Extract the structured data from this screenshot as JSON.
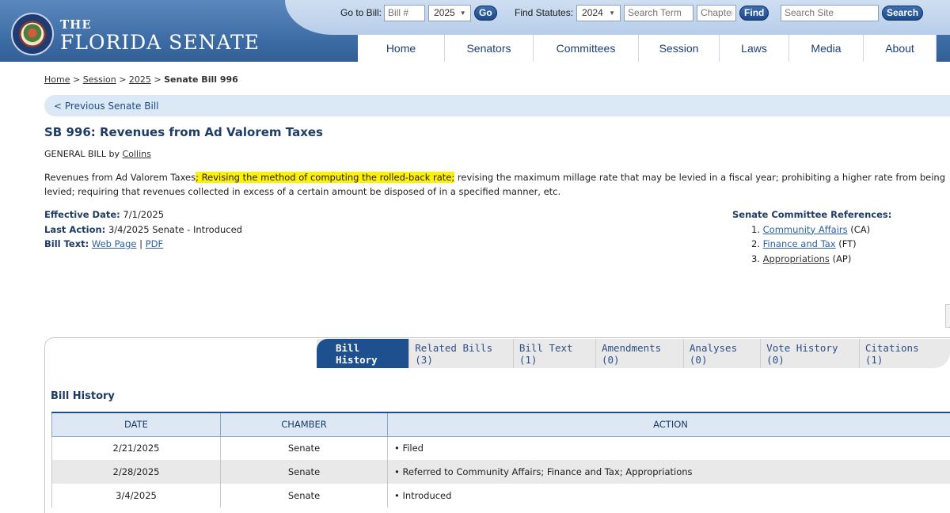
{
  "site": {
    "brand_the": "THE",
    "brand_name": "FLORIDA SENATE"
  },
  "topbar": {
    "goto_label": "Go to Bill:",
    "bill_placeholder": "Bill #",
    "year_value": "2025",
    "go_label": "Go",
    "statutes_label": "Find Statutes:",
    "statutes_year": "2024",
    "search_term_placeholder": "Search Term",
    "chapter_placeholder": "Chapter",
    "find_label": "Find",
    "site_search_placeholder": "Search Site",
    "search_label": "Search"
  },
  "nav": {
    "items": [
      "Home",
      "Senators",
      "Committees",
      "Session",
      "Laws",
      "Media",
      "About"
    ]
  },
  "breadcrumb": {
    "home": "Home",
    "session": "Session",
    "year": "2025",
    "sep": ">",
    "current": "Senate Bill 996"
  },
  "prev_bill": "< Previous Senate Bill",
  "bill": {
    "title": "SB 996: Revenues from Ad Valorem Taxes",
    "type_text": "GENERAL BILL by",
    "sponsor": "Collins",
    "desc_start": "Revenues from Ad Valorem Taxes",
    "desc_highlight": "; Revising the method of computing the rolled-back rate;",
    "desc_rest": " revising the maximum millage rate that may be levied in a fiscal year; prohibiting a higher rate from being levied; requiring that revenues collected in excess of a certain amount be disposed of in a specified manner, etc.",
    "effective_label": "Effective Date:",
    "effective_value": "7/1/2025",
    "last_action_label": "Last Action:",
    "last_action_value": "3/4/2025 Senate - Introduced",
    "bill_text_label": "Bill Text:",
    "web_page": "Web Page",
    "pdf": "PDF",
    "text_sep": "|"
  },
  "committee_refs": {
    "title": "Senate Committee References:",
    "items": [
      {
        "num": "1.",
        "name": "Community Affairs",
        "code": "(CA)"
      },
      {
        "num": "2.",
        "name": "Finance and Tax",
        "code": "(FT)"
      },
      {
        "num": "3.",
        "name": "Appropriations",
        "code": "(AP)"
      }
    ]
  },
  "tabs": [
    "Bill History",
    "Related Bills (3)",
    "Bill Text (1)",
    "Amendments (0)",
    "Analyses (0)",
    "Vote History (0)",
    "Citations (1)"
  ],
  "history": {
    "title": "Bill History",
    "columns": [
      "DATE",
      "CHAMBER",
      "ACTION"
    ],
    "rows": [
      {
        "date": "2/21/2025",
        "chamber": "Senate",
        "action": "• Filed"
      },
      {
        "date": "2/28/2025",
        "chamber": "Senate",
        "action": "• Referred to Community Affairs; Finance and Tax; Appropriations"
      },
      {
        "date": "3/4/2025",
        "chamber": "Senate",
        "action": "• Introduced"
      }
    ]
  }
}
